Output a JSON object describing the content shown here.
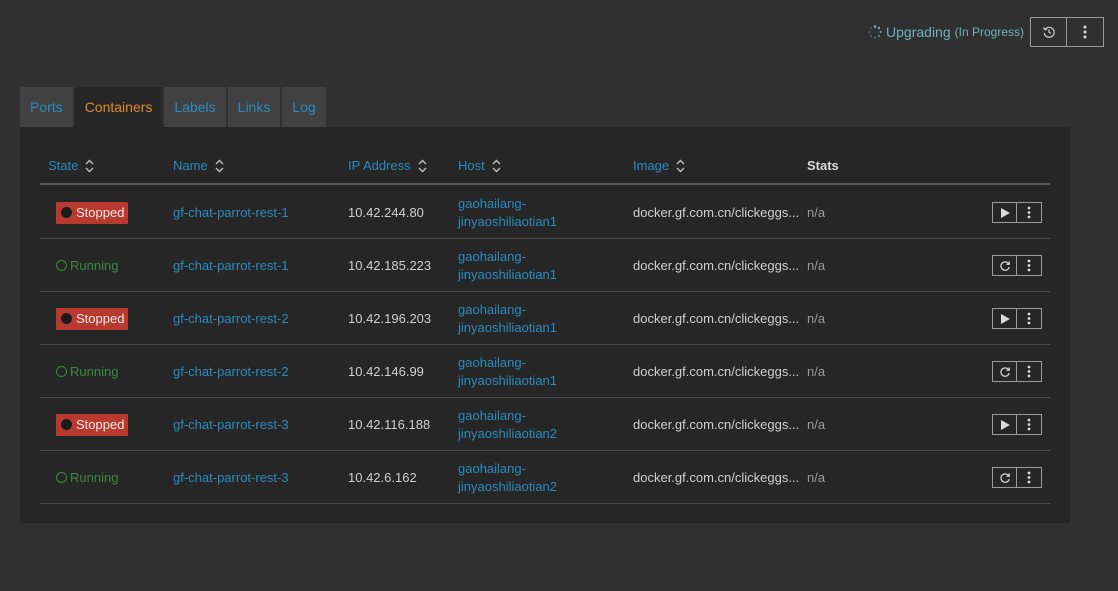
{
  "status": {
    "label": "Upgrading",
    "sub": "(In Progress)",
    "color": "#6fb1bd"
  },
  "top_buttons": [
    {
      "icon": "history-icon"
    },
    {
      "icon": "more-vertical-icon"
    }
  ],
  "tabs": [
    {
      "label": "Ports",
      "active": false
    },
    {
      "label": "Containers",
      "active": true
    },
    {
      "label": "Labels",
      "active": false
    },
    {
      "label": "Links",
      "active": false
    },
    {
      "label": "Log",
      "active": false
    }
  ],
  "table": {
    "columns": [
      {
        "label": "State",
        "sortable": true
      },
      {
        "label": "Name",
        "sortable": true
      },
      {
        "label": "IP Address",
        "sortable": true
      },
      {
        "label": "Host",
        "sortable": true
      },
      {
        "label": "Image",
        "sortable": true
      },
      {
        "label": "Stats",
        "sortable": false
      }
    ],
    "rows": [
      {
        "state": "Stopped",
        "name": "gf-chat-parrot-rest-1",
        "ip": "10.42.244.80",
        "host_1": "gaohailang-",
        "host_2": "jinyaoshiliaotian1",
        "image": "docker.gf.com.cn/clickeggs...",
        "stats": "n/a",
        "action": "play-icon"
      },
      {
        "state": "Running",
        "name": "gf-chat-parrot-rest-1",
        "ip": "10.42.185.223",
        "host_1": "gaohailang-",
        "host_2": "jinyaoshiliaotian1",
        "image": "docker.gf.com.cn/clickeggs...",
        "stats": "n/a",
        "action": "restart-icon"
      },
      {
        "state": "Stopped",
        "name": "gf-chat-parrot-rest-2",
        "ip": "10.42.196.203",
        "host_1": "gaohailang-",
        "host_2": "jinyaoshiliaotian1",
        "image": "docker.gf.com.cn/clickeggs...",
        "stats": "n/a",
        "action": "play-icon"
      },
      {
        "state": "Running",
        "name": "gf-chat-parrot-rest-2",
        "ip": "10.42.146.99",
        "host_1": "gaohailang-",
        "host_2": "jinyaoshiliaotian1",
        "image": "docker.gf.com.cn/clickeggs...",
        "stats": "n/a",
        "action": "restart-icon"
      },
      {
        "state": "Stopped",
        "name": "gf-chat-parrot-rest-3",
        "ip": "10.42.116.188",
        "host_1": "gaohailang-",
        "host_2": "jinyaoshiliaotian2",
        "image": "docker.gf.com.cn/clickeggs...",
        "stats": "n/a",
        "action": "play-icon"
      },
      {
        "state": "Running",
        "name": "gf-chat-parrot-rest-3",
        "ip": "10.42.6.162",
        "host_1": "gaohailang-",
        "host_2": "jinyaoshiliaotian2",
        "image": "docker.gf.com.cn/clickeggs...",
        "stats": "n/a",
        "action": "restart-icon"
      }
    ]
  },
  "colors": {
    "link": "#2a8bbf",
    "tab_active": "#e08a2c",
    "stopped": "#b83a2f",
    "running": "#3a8a3e"
  }
}
